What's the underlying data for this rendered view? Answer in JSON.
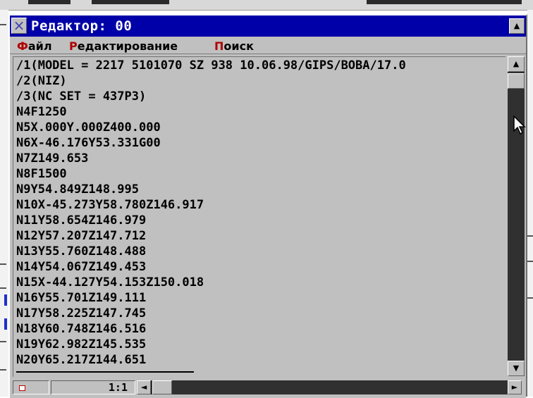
{
  "window": {
    "title": "Редактор: 00",
    "close_icon": "×",
    "title_scroll_icon": "▲"
  },
  "menu": [
    {
      "hot": "Ф",
      "rest": "айл"
    },
    {
      "hot": "Р",
      "rest": "едактирование"
    },
    {
      "hot": "П",
      "rest": "оиск"
    }
  ],
  "editor": {
    "lines": [
      "/1(MODEL = 2217 5101070 SZ 938 10.06.98/GIPS/BOBA/17.0",
      "/2(NIZ)",
      "/3(NC SET = 437P3)",
      "N4F1250",
      "N5X.000Y.000Z400.000",
      "N6X-46.176Y53.331G00",
      "N7Z149.653",
      "N8F1500",
      "N9Y54.849Z148.995",
      "N10X-45.273Y58.780Z146.917",
      "N11Y58.654Z146.979",
      "N12Y57.207Z147.712",
      "N13Y55.760Z148.488",
      "N14Y54.067Z149.453",
      "N15X-44.127Y54.153Z150.018",
      "N16Y55.701Z149.111",
      "N17Y58.225Z147.745",
      "N18Y60.748Z146.516",
      "N19Y62.982Z145.535",
      "N20Y65.217Z144.651"
    ]
  },
  "scrollbar": {
    "up_icon": "▲",
    "down_icon": "▼",
    "left_icon": "◄",
    "right_icon": "►"
  },
  "status": {
    "position": "1:1"
  }
}
